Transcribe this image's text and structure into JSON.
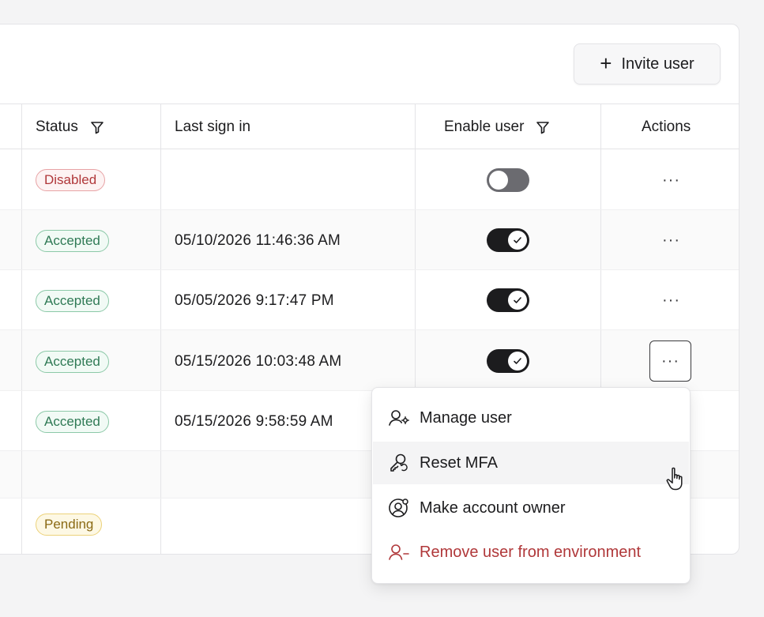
{
  "header": {
    "invite_label": "Invite user"
  },
  "columns": {
    "status": "Status",
    "last_sign_in": "Last sign in",
    "enable_user": "Enable user",
    "actions": "Actions"
  },
  "rows": [
    {
      "status": "Disabled",
      "status_type": "disabled",
      "last_sign_in": "",
      "enabled": false
    },
    {
      "status": "Accepted",
      "status_type": "accepted",
      "last_sign_in": "05/10/2026 11:46:36 AM",
      "enabled": true
    },
    {
      "status": "Accepted",
      "status_type": "accepted",
      "last_sign_in": "05/05/2026 9:17:47 PM",
      "enabled": true
    },
    {
      "status": "Accepted",
      "status_type": "accepted",
      "last_sign_in": "05/15/2026 10:03:48 AM",
      "enabled": true
    },
    {
      "status": "Accepted",
      "status_type": "accepted",
      "last_sign_in": "05/15/2026 9:58:59 AM",
      "enabled": true
    },
    {
      "status": "",
      "status_type": "",
      "last_sign_in": "",
      "enabled": null
    },
    {
      "status": "Pending",
      "status_type": "pending",
      "last_sign_in": "",
      "enabled": null
    }
  ],
  "actions_label": "···",
  "menu": {
    "items": [
      {
        "label": "Manage user",
        "icon": "user-gear-icon"
      },
      {
        "label": "Reset MFA",
        "icon": "key-reset-icon"
      },
      {
        "label": "Make account owner",
        "icon": "user-badge-icon"
      },
      {
        "label": "Remove user from environment",
        "icon": "user-minus-icon"
      }
    ]
  },
  "colors": {
    "danger": "#b0383a",
    "accepted": "#2f7a55",
    "pending": "#8a6a14",
    "toggle_on": "#1c1c1e"
  }
}
